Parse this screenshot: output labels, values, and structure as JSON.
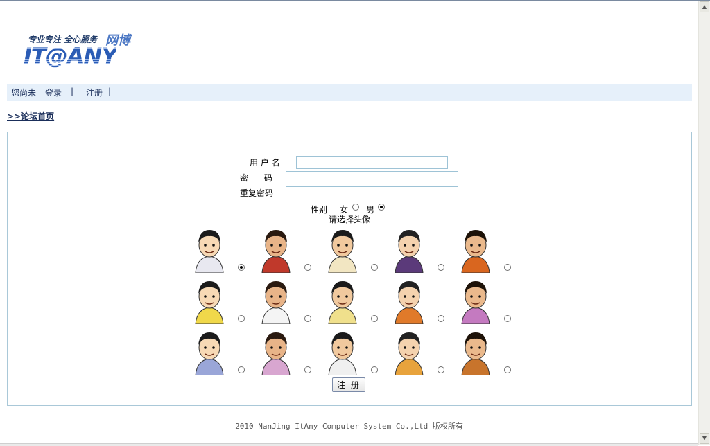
{
  "logo": {
    "slogan": "专业专注  全心服务",
    "brand_cn": "网博",
    "brand_en": "IT@ANY"
  },
  "nav": {
    "status": "您尚未",
    "login": "登录",
    "sep1": "|",
    "register": "注册",
    "sep2": "|"
  },
  "breadcrumb": ">>论坛首页",
  "form": {
    "username_label": "用 户 名",
    "password_label": "密      码",
    "confirm_label": "重复密码",
    "gender_label": "性别",
    "female": "女",
    "male": "男",
    "gender_selected": "male",
    "avatar_prompt": "请选择头像",
    "avatar_selected_index": 0,
    "avatars": [
      "avatar-1",
      "avatar-2",
      "avatar-3",
      "avatar-4",
      "avatar-5",
      "avatar-6",
      "avatar-7",
      "avatar-8",
      "avatar-9",
      "avatar-10",
      "avatar-11",
      "avatar-12",
      "avatar-13",
      "avatar-14",
      "avatar-15"
    ],
    "submit_label": "注 册"
  },
  "footer": "2010 NanJing ItAny Computer System Co.,Ltd 版权所有"
}
